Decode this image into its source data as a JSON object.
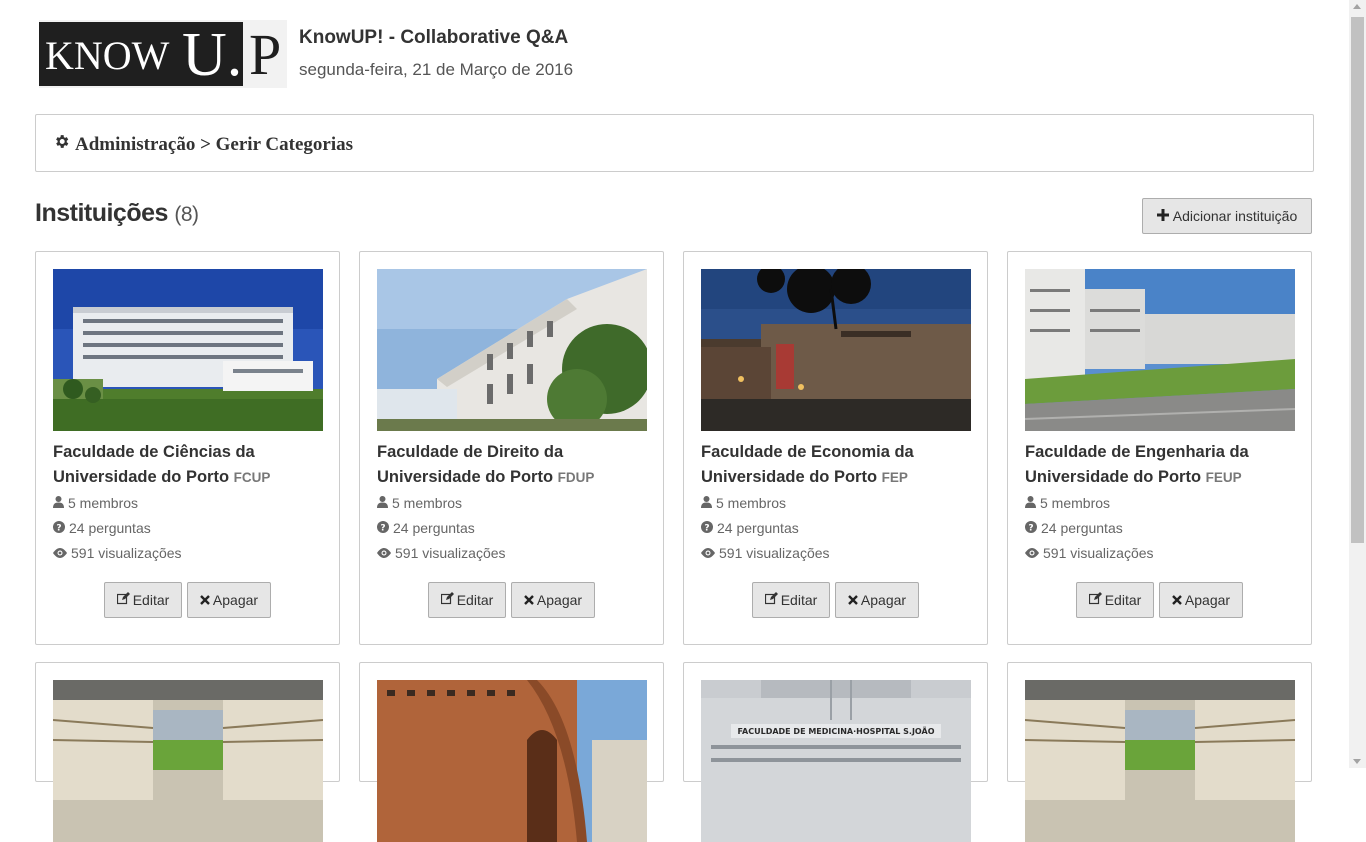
{
  "header": {
    "logo": {
      "part1": "KNOW",
      "part2": "U.",
      "part3": "P"
    },
    "title": "KnowUP! - Collaborative Q&A",
    "date": "segunda-feira, 21 de Março de 2016"
  },
  "breadcrumb": {
    "icon": "gear-icon",
    "text": "Administração > Gerir Categorias"
  },
  "section": {
    "title": "Instituições",
    "count": "(8)",
    "add_button": "Adicionar instituição",
    "add_icon": "plus-icon"
  },
  "institutions": [
    {
      "name": "Faculdade de Ciências da Universidade do Porto",
      "abbr": "FCUP",
      "members": "5 membros",
      "questions": "24 perguntas",
      "views": "591 visualizações",
      "edit": "Editar",
      "delete": "Apagar"
    },
    {
      "name": "Faculdade de Direito da Universidade do Porto",
      "abbr": "FDUP",
      "members": "5 membros",
      "questions": "24 perguntas",
      "views": "591 visualizações",
      "edit": "Editar",
      "delete": "Apagar"
    },
    {
      "name": "Faculdade de Economia da Universidade do Porto",
      "abbr": "FEP",
      "members": "5 membros",
      "questions": "24 perguntas",
      "views": "591 visualizações",
      "edit": "Editar",
      "delete": "Apagar"
    },
    {
      "name": "Faculdade de Engenharia da Universidade do Porto",
      "abbr": "FEUP",
      "members": "5 membros",
      "questions": "24 perguntas",
      "views": "591 visualizações",
      "edit": "Editar",
      "delete": "Apagar"
    }
  ],
  "colors": {
    "button_bg": "#e6e6e6",
    "border": "#cccccc",
    "text": "#333333",
    "muted": "#666666"
  }
}
